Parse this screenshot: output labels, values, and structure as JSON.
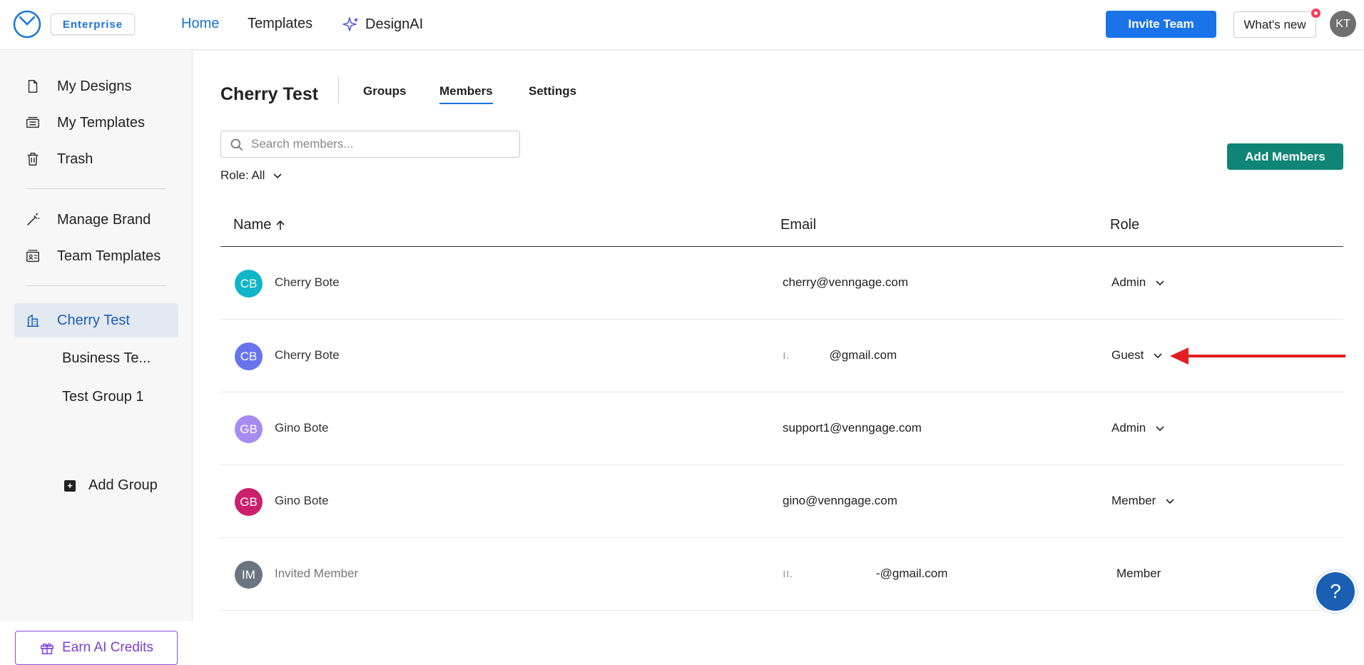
{
  "header": {
    "badge": "Enterprise",
    "nav": [
      "Home",
      "Templates",
      "DesignAI"
    ],
    "invite_label": "Invite Team",
    "whats_new_label": "What's new",
    "user_initials": "KT"
  },
  "sidebar": {
    "items": [
      {
        "label": "My Designs",
        "icon": "file-icon"
      },
      {
        "label": "My Templates",
        "icon": "templates-icon"
      },
      {
        "label": "Trash",
        "icon": "trash-icon"
      },
      {
        "label": "Manage Brand",
        "icon": "magic-wand-icon"
      },
      {
        "label": "Team Templates",
        "icon": "team-templates-icon"
      },
      {
        "label": "Cherry Test",
        "icon": "building-icon"
      }
    ],
    "subitems": [
      "Business Te...",
      "Test Group 1"
    ],
    "add_group_label": "Add Group",
    "earn_label": "Earn AI Credits"
  },
  "main": {
    "team_name": "Cherry Test",
    "tabs": [
      "Groups",
      "Members",
      "Settings"
    ],
    "search_placeholder": "Search members...",
    "role_filter": "Role: All",
    "add_members_label": "Add Members",
    "columns": [
      "Name",
      "Email",
      "Role"
    ],
    "rows": [
      {
        "initials": "CB",
        "name": "Cherry Bote",
        "email": "cherry@venngage.com",
        "role": "Admin",
        "color": "#10b5c8"
      },
      {
        "initials": "CB",
        "name": "Cherry Bote",
        "email": "@gmail.com",
        "email_prefix": "ı.",
        "role": "Guest",
        "color": "#6873ec"
      },
      {
        "initials": "GB",
        "name": "Gino Bote",
        "email": "support1@venngage.com",
        "role": "Admin",
        "color": "#a78bf0"
      },
      {
        "initials": "GB",
        "name": "Gino Bote",
        "email": "gino@venngage.com",
        "role": "Member",
        "color": "#cc1f6d"
      },
      {
        "initials": "IM",
        "name": "Invited Member",
        "email": "-@gmail.com",
        "email_prefix": "ıı.  ",
        "role": "Member",
        "color": "#6b7580"
      }
    ]
  },
  "help_label": "?",
  "colors": {
    "accent": "#1a73e8",
    "add_members": "#0f8577",
    "earn": "#7b3fd0",
    "arrow": "#e02020"
  }
}
